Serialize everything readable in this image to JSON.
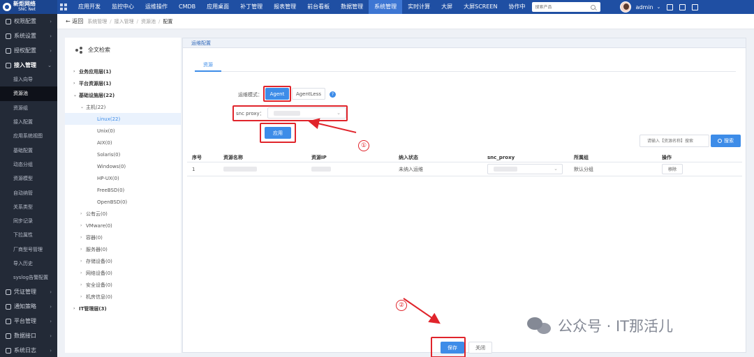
{
  "brand": {
    "name": "新炬网络",
    "sub": "SNC Net"
  },
  "nav": [
    "应用开发",
    "监控中心",
    "运维操作",
    "CMDB",
    "应用桌面",
    "补丁管理",
    "报表管理",
    "前台看板",
    "数据管理",
    "系统管理",
    "实时计算",
    "大屏",
    "大屏SCREEN",
    "协作中"
  ],
  "nav_active": "系统管理",
  "search": {
    "placeholder": "搜索产品"
  },
  "user": {
    "name": "admin"
  },
  "sidebar": {
    "top": [
      "权限配置",
      "系统设置",
      "授权配置"
    ],
    "open": "接入管理",
    "subs": [
      "接入向导",
      "资源池",
      "资源组",
      "接入配置",
      "应用系统视图",
      "基础配置",
      "动态分组",
      "资源模型",
      "自动纳管",
      "关系类型",
      "同步记录",
      "下拉属性",
      "厂商型号管理",
      "导入历史",
      "syslog告警配置"
    ],
    "active_sub": "资源池",
    "bottom": [
      "凭证管理",
      "通知策略",
      "平台管理",
      "数据接口",
      "系统日志"
    ]
  },
  "breadcrumb": {
    "back": "← 返回",
    "items": [
      "系统管理",
      "接入管理",
      "资源池",
      "配置"
    ]
  },
  "tree": {
    "title": "全文检索",
    "nodes": [
      {
        "label": "业务应用层(1)",
        "level": 0,
        "caret": "›"
      },
      {
        "label": "平台资源层(1)",
        "level": 0,
        "caret": "›"
      },
      {
        "label": "基础设施层(22)",
        "level": 0,
        "caret": "⌄"
      },
      {
        "label": "主机(22)",
        "level": 1,
        "caret": "⌄"
      },
      {
        "label": "Linux(22)",
        "level": 2,
        "caret": "",
        "selected": true
      },
      {
        "label": "Unix(0)",
        "level": 2,
        "caret": ""
      },
      {
        "label": "AIX(0)",
        "level": 2,
        "caret": ""
      },
      {
        "label": "Solaris(0)",
        "level": 2,
        "caret": ""
      },
      {
        "label": "Windows(0)",
        "level": 2,
        "caret": ""
      },
      {
        "label": "HP-UX(0)",
        "level": 2,
        "caret": ""
      },
      {
        "label": "FreeBSD(0)",
        "level": 2,
        "caret": ""
      },
      {
        "label": "OpenBSD(0)",
        "level": 2,
        "caret": ""
      },
      {
        "label": "公有云(0)",
        "level": 1,
        "caret": "›"
      },
      {
        "label": "VMware(0)",
        "level": 1,
        "caret": "›"
      },
      {
        "label": "容器(0)",
        "level": 1,
        "caret": "›"
      },
      {
        "label": "服务器(0)",
        "level": 1,
        "caret": "›"
      },
      {
        "label": "存储设备(0)",
        "level": 1,
        "caret": "›"
      },
      {
        "label": "网络设备(0)",
        "level": 1,
        "caret": "›"
      },
      {
        "label": "安全设备(0)",
        "level": 1,
        "caret": "›"
      },
      {
        "label": "机房信息(0)",
        "level": 1,
        "caret": "›"
      },
      {
        "label": "IT管理层(3)",
        "level": 0,
        "caret": "›"
      }
    ]
  },
  "panel": {
    "header": "运维配置",
    "tab": "资源",
    "mode_label": "运维模式：",
    "mode_agent": "Agent",
    "mode_agentless": "AgentLess",
    "help": "?",
    "proxy_label": "snc proxy：",
    "apply": "应用",
    "search_placeholder": "请输入【资源名称】搜索",
    "search_btn": "搜索",
    "columns": [
      "序号",
      "资源名称",
      "资源IP",
      "纳入状态",
      "snc_proxy",
      "所属组",
      "操作"
    ],
    "rows": [
      {
        "no": "1",
        "status": "未纳入运维",
        "group": "默认分组",
        "action": "移除"
      }
    ],
    "save": "保存",
    "close": "关闭"
  },
  "annotations": {
    "step1": "①",
    "step2": "②",
    "arrow_color": "#e0242b"
  },
  "watermark": "公众号 · IT那活儿",
  "colors": {
    "topbar": "#1f4fa3",
    "accent": "#3d8ce8",
    "sidebar": "#232a37",
    "highlight": "#e0242b"
  }
}
